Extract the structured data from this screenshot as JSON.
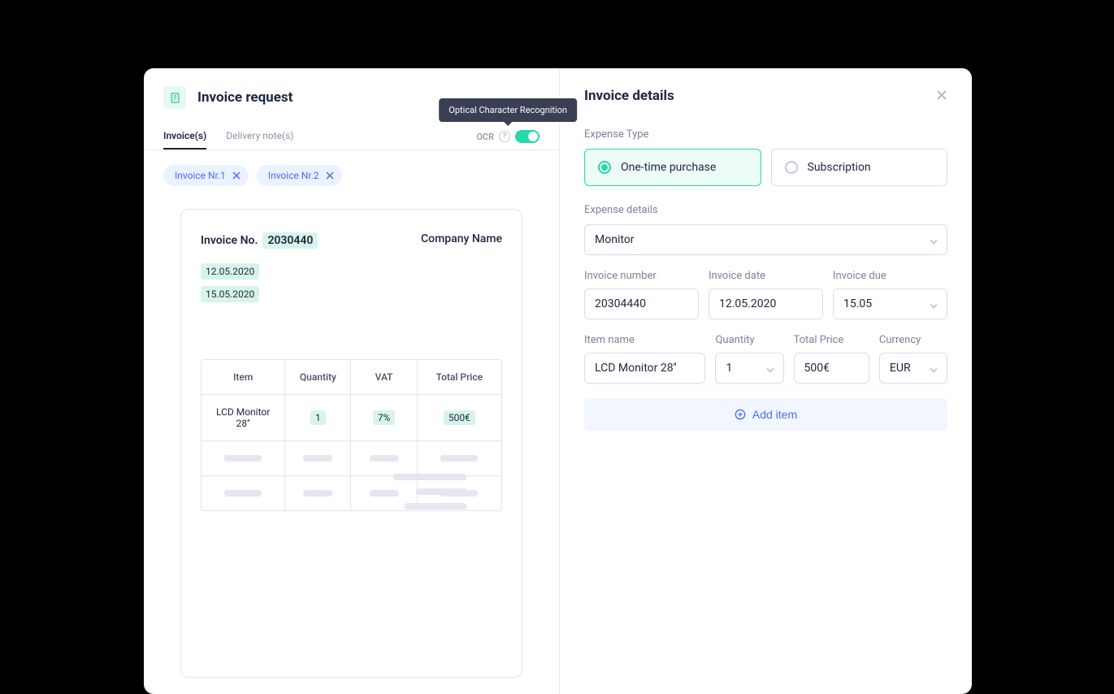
{
  "left": {
    "title": "Invoice request",
    "tabs": {
      "invoices": "Invoice(s)",
      "delivery": "Delivery note(s)"
    },
    "ocr_label": "OCR",
    "tooltip": "Optical Character Recognition",
    "chips": {
      "c1": "Invoice Nr.1",
      "c2": "Invoice Nr.2"
    },
    "preview": {
      "inv_no_label": "Invoice No.",
      "inv_no": "2030440",
      "company": "Company Name",
      "date1": "12.05.2020",
      "date2": "15.05.2020",
      "headers": {
        "item": "Item",
        "qty": "Quantity",
        "vat": "VAT",
        "total": "Total Price"
      },
      "row1": {
        "item": "LCD Monitor 28''",
        "qty": "1",
        "vat": "7%",
        "total": "500€"
      }
    }
  },
  "right": {
    "title": "Invoice details",
    "expense_type_label": "Expense Type",
    "opt_onetime": "One-time purchase",
    "opt_subscription": "Subscription",
    "expense_details_label": "Expense details",
    "expense_details_value": "Monitor",
    "inv_number_label": "Invoice number",
    "inv_number_value": "20304440",
    "inv_date_label": "Invoice date",
    "inv_date_value": "12.05.2020",
    "inv_due_label": "Invoice due",
    "inv_due_value": "15.05",
    "item_name_label": "Item name",
    "item_name_value": "LCD Monitor 28''",
    "qty_label": "Quantity",
    "qty_value": "1",
    "total_label": "Total Price",
    "total_value": "500€",
    "currency_label": "Currency",
    "currency_value": "EUR",
    "add_item": "Add item"
  }
}
